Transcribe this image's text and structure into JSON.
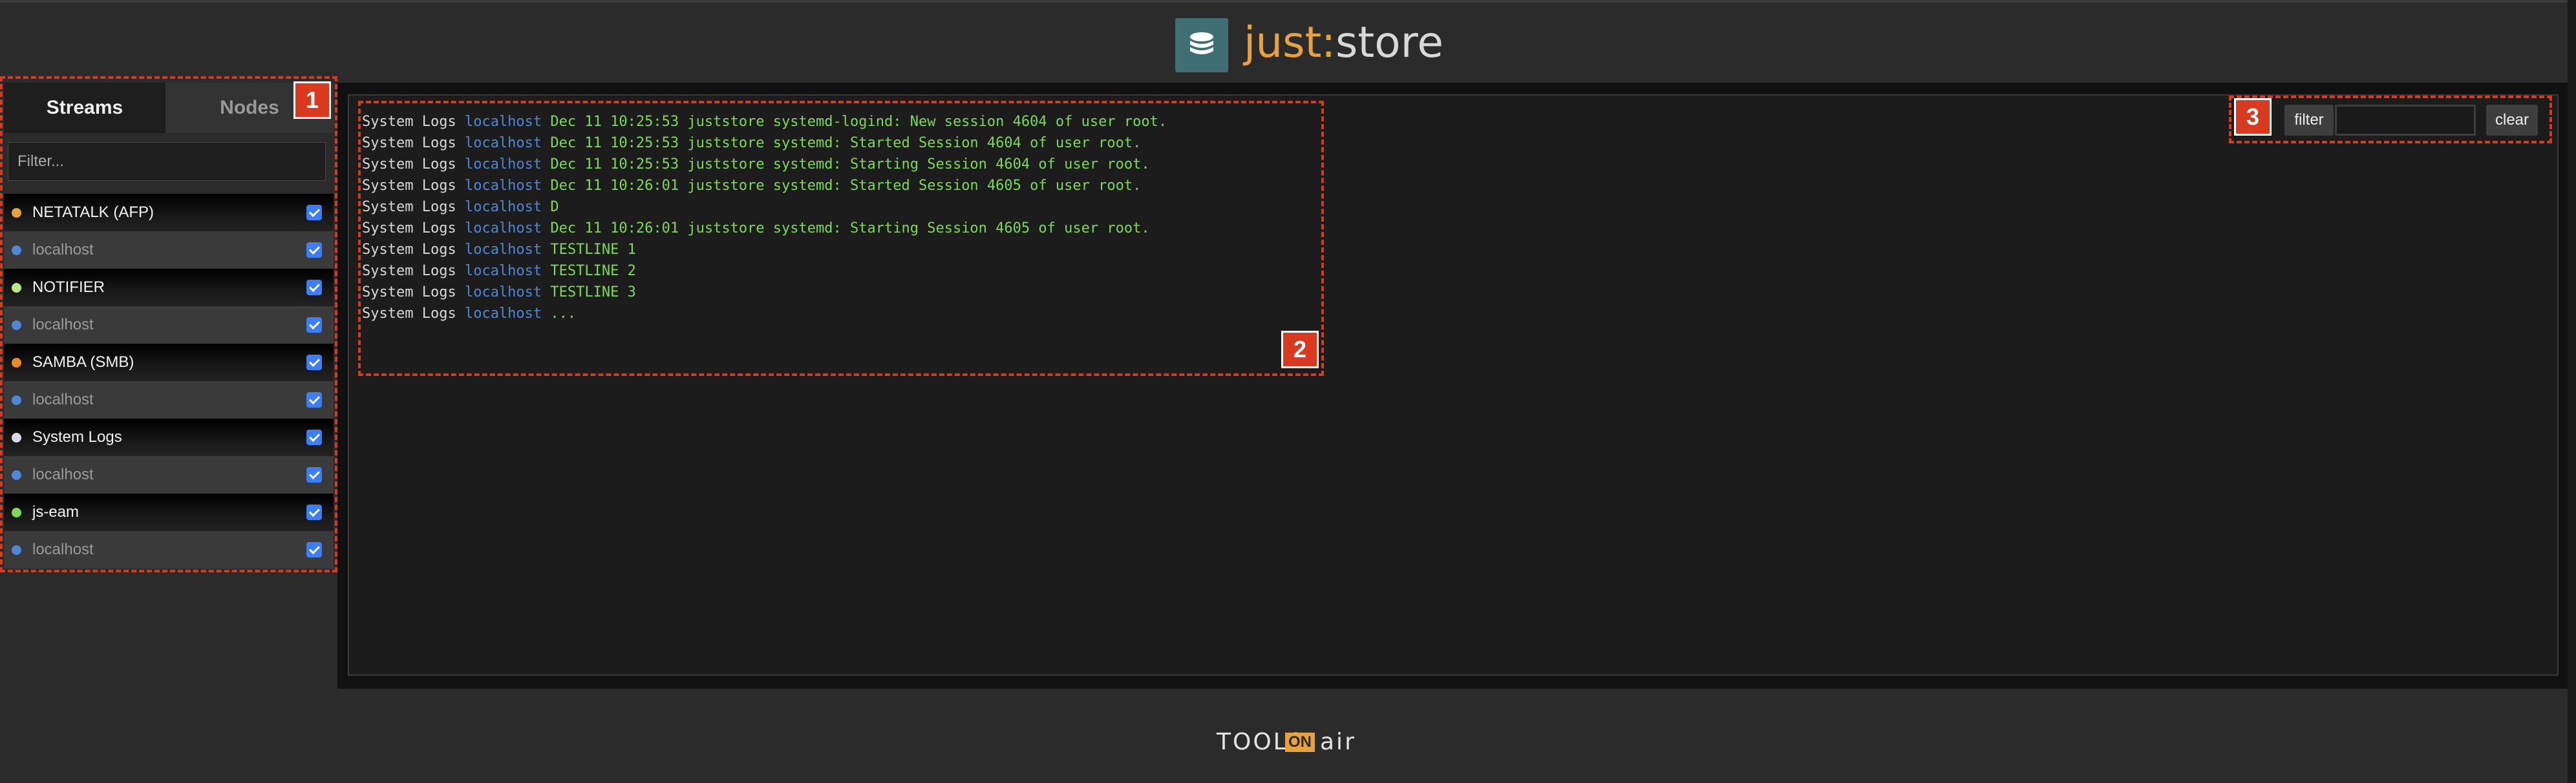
{
  "header": {
    "brand_just": "just",
    "brand_colon": ":",
    "brand_store": "store",
    "logo_icon": "database-icon"
  },
  "sidebar": {
    "tabs": [
      {
        "label": "Streams",
        "active": true
      },
      {
        "label": "Nodes",
        "active": false
      }
    ],
    "filter_placeholder": "Filter...",
    "items": [
      {
        "label": "NETATALK (AFP)",
        "type": "stream",
        "dot_color": "#e8a23c",
        "checked": true
      },
      {
        "label": "localhost",
        "type": "host",
        "dot_color": "#4f86d6",
        "checked": true
      },
      {
        "label": "NOTIFIER",
        "type": "stream",
        "dot_color": "#b8e986",
        "checked": true
      },
      {
        "label": "localhost",
        "type": "host",
        "dot_color": "#4f86d6",
        "checked": true
      },
      {
        "label": "SAMBA (SMB)",
        "type": "stream",
        "dot_color": "#e8892c",
        "checked": true
      },
      {
        "label": "localhost",
        "type": "host",
        "dot_color": "#4f86d6",
        "checked": true
      },
      {
        "label": "System Logs",
        "type": "stream",
        "dot_color": "#d8d8e8",
        "checked": true
      },
      {
        "label": "localhost",
        "type": "host",
        "dot_color": "#4f86d6",
        "checked": true
      },
      {
        "label": "js-eam",
        "type": "stream",
        "dot_color": "#7ed957",
        "checked": true
      },
      {
        "label": "localhost",
        "type": "host",
        "dot_color": "#4f86d6",
        "checked": true
      }
    ]
  },
  "log": {
    "lines": [
      {
        "source": "System Logs",
        "host": "localhost",
        "message": "Dec 11 10:25:53 juststore systemd-logind: New session 4604 of user root."
      },
      {
        "source": "System Logs",
        "host": "localhost",
        "message": "Dec 11 10:25:53 juststore systemd: Started Session 4604 of user root."
      },
      {
        "source": "System Logs",
        "host": "localhost",
        "message": "Dec 11 10:25:53 juststore systemd: Starting Session 4604 of user root."
      },
      {
        "source": "System Logs",
        "host": "localhost",
        "message": "Dec 11 10:26:01 juststore systemd: Started Session 4605 of user root."
      },
      {
        "source": "System Logs",
        "host": "localhost",
        "message": "D"
      },
      {
        "source": "System Logs",
        "host": "localhost",
        "message": "Dec 11 10:26:01 juststore systemd: Starting Session 4605 of user root."
      },
      {
        "source": "System Logs",
        "host": "localhost",
        "message": "TESTLINE 1"
      },
      {
        "source": "System Logs",
        "host": "localhost",
        "message": "TESTLINE 2"
      },
      {
        "source": "System Logs",
        "host": "localhost",
        "message": "TESTLINE 3"
      },
      {
        "source": "System Logs",
        "host": "localhost",
        "message": "..."
      }
    ]
  },
  "toolbar": {
    "filter_label": "filter",
    "filter_value": "",
    "clear_label": "clear"
  },
  "annotations": {
    "badge1": "1",
    "badge2": "2",
    "badge3": "3",
    "color": "#d93a1f"
  },
  "footer": {
    "tools": "TOOLS",
    "on": "ON",
    "air": "air"
  }
}
